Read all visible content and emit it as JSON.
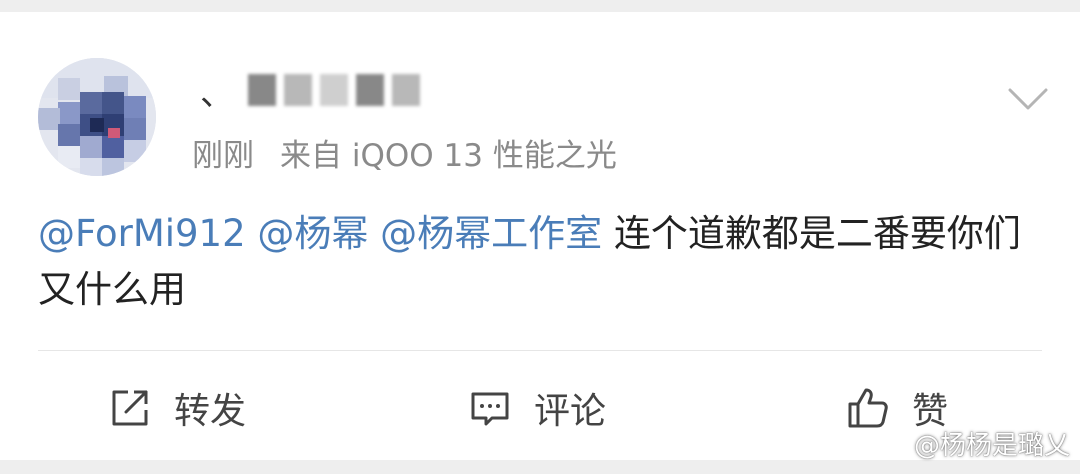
{
  "post": {
    "username_prefix": "、",
    "time": "刚刚",
    "source": "来自 iQOO 13 性能之光",
    "mentions": [
      "@ForMi912",
      "@杨幂",
      "@杨幂工作室"
    ],
    "text": "连个道歉都是二番要你们又什么用"
  },
  "actions": {
    "repost_label": "转发",
    "comment_label": "评论",
    "like_label": "赞"
  },
  "watermark": {
    "text": "@杨杨是璐乂"
  },
  "colors": {
    "mention": "#4a7db8",
    "meta": "#8a8a8a"
  }
}
